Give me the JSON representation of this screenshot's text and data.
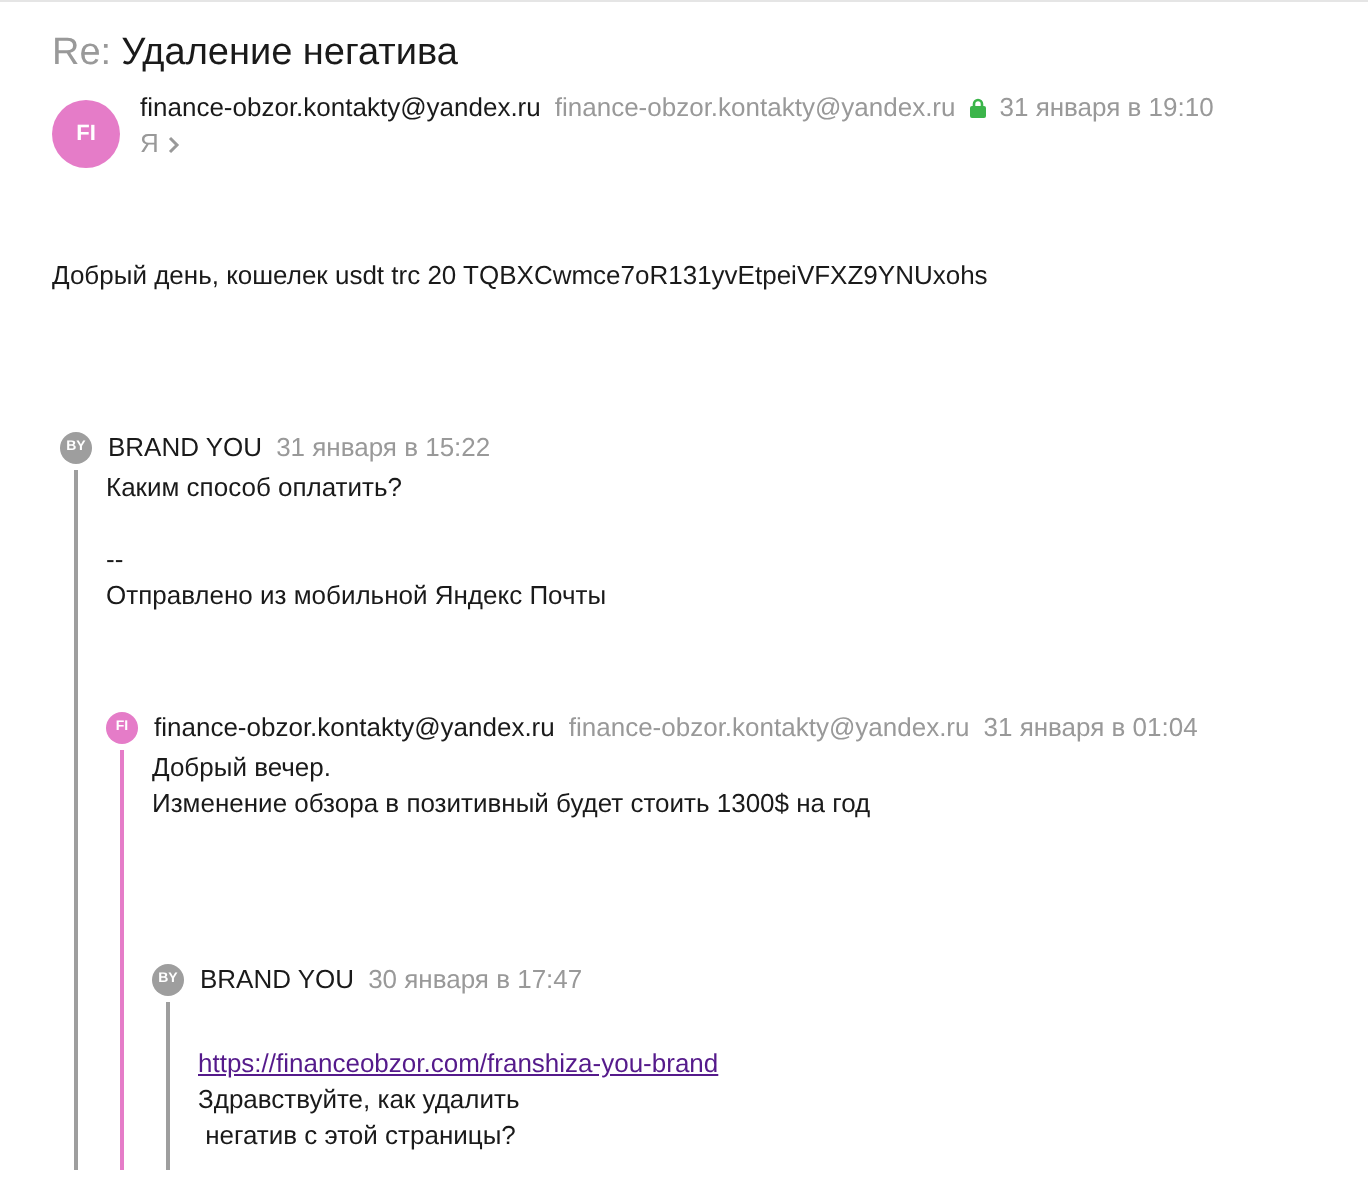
{
  "subject": {
    "prefix": "Re:",
    "title": "Удаление негатива"
  },
  "message": {
    "avatar": {
      "initials": "FI",
      "color": "#e57cc8"
    },
    "sender_name": "finance-obzor.kontakty@yandex.ru",
    "sender_email": "finance-obzor.kontakty@yandex.ru",
    "secure": true,
    "date": "31 января в 19:10",
    "recipient": "Я",
    "body": "Добрый день, кошелек usdt trc 20 TQBXCwmce7oR131yvEtpeiVFXZ9YNUxohs",
    "quote": {
      "avatar": {
        "initials": "BY"
      },
      "color": "#9e9e9e",
      "sender_name": "BRAND YOU",
      "date": "31 января в 15:22",
      "paragraphs": [
        [
          {
            "kind": "text",
            "text": "Каким способ оплатить?"
          }
        ],
        [
          {
            "kind": "text",
            "text": "--"
          },
          {
            "kind": "text",
            "text": "Отправлено из мобильной Яндекс Почты"
          }
        ]
      ],
      "quote": {
        "avatar": {
          "initials": "FI"
        },
        "color": "#e57cc8",
        "sender_name": "finance-obzor.kontakty@yandex.ru",
        "sender_email": "finance-obzor.kontakty@yandex.ru",
        "date": "31 января в 01:04",
        "paragraphs": [
          [
            {
              "kind": "text",
              "text": "Добрый вечер."
            },
            {
              "kind": "text",
              "text": "Изменение обзора в позитивный будет стоить 1300$ на год"
            }
          ]
        ],
        "quote": {
          "avatar": {
            "initials": "BY"
          },
          "color": "#9e9e9e",
          "sender_name": "BRAND YOU",
          "date": "30 января в 17:47",
          "paragraphs": [
            [
              {
                "kind": "link",
                "text": "https://financeobzor.com/franshiza-you-brand"
              },
              {
                "kind": "text",
                "text": "Здравствуйте, как удалить"
              },
              {
                "kind": "text",
                "text": " негатив с этой страницы?"
              }
            ]
          ]
        }
      }
    }
  }
}
